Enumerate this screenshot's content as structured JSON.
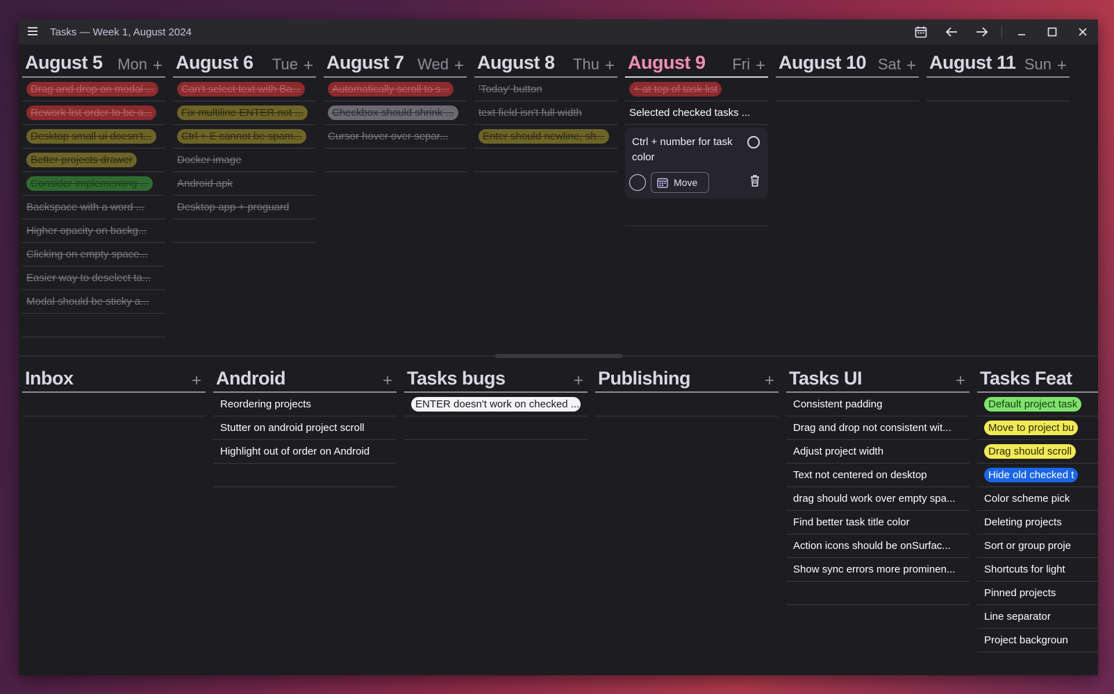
{
  "window": {
    "title": "Tasks — Week 1, August 2024",
    "toolbar": {
      "calendar_icon": "calendar-icon",
      "back_icon": "arrow-left-icon",
      "forward_icon": "arrow-right-icon",
      "minimize_icon": "minimize-icon",
      "maximize_icon": "maximize-icon",
      "close_icon": "close-icon"
    }
  },
  "days": [
    {
      "date": "August 5",
      "weekday": "Mon",
      "add": "+",
      "tasks": [
        {
          "text": "Drag and drop on modal ...",
          "style": "red"
        },
        {
          "text": "Rework list order to be a...",
          "style": "red"
        },
        {
          "text": "Desktop small ui doesn't...",
          "style": "olive"
        },
        {
          "text": "Better projects drawer",
          "style": "olive"
        },
        {
          "text": "Consider implementing ...",
          "style": "green"
        },
        {
          "text": "Backspace with a word ...",
          "style": "plain"
        },
        {
          "text": "Higher opacity on backg...",
          "style": "plain"
        },
        {
          "text": "Clicking on empty space...",
          "style": "plain"
        },
        {
          "text": "Easier way to deselect ta...",
          "style": "plain"
        },
        {
          "text": "Modal should be sticky a...",
          "style": "plain"
        }
      ]
    },
    {
      "date": "August 6",
      "weekday": "Tue",
      "add": "+",
      "tasks": [
        {
          "text": "Can't select text with Ba...",
          "style": "red"
        },
        {
          "text": "Fix multiline ENTER not ...",
          "style": "olive"
        },
        {
          "text": "Ctrl + E cannot be spam...",
          "style": "olive"
        },
        {
          "text": "Docker image",
          "style": "plain"
        },
        {
          "text": "Android apk",
          "style": "plain"
        },
        {
          "text": "Desktop app + proguard",
          "style": "plain"
        }
      ]
    },
    {
      "date": "August 7",
      "weekday": "Wed",
      "add": "+",
      "tasks": [
        {
          "text": "Automatically scroll to s...",
          "style": "red"
        },
        {
          "text": "Checkbox should shrink ...",
          "style": "gray"
        },
        {
          "text": "Cursor hover over separ...",
          "style": "plain"
        }
      ]
    },
    {
      "date": "August 8",
      "weekday": "Thu",
      "add": "+",
      "tasks": [
        {
          "text": "'Today' button",
          "style": "plain"
        },
        {
          "text": "text field isn't full width",
          "style": "plain"
        },
        {
          "text": "Enter should newline, sh...",
          "style": "olive"
        }
      ]
    },
    {
      "date": "August 9",
      "weekday": "Fri",
      "add": "+",
      "today": true,
      "tasks": [
        {
          "text": "+ at top of task list",
          "style": "red"
        },
        {
          "text": "Selected checked tasks ...",
          "style": "active"
        }
      ],
      "editing": {
        "text": "Ctrl + number for task color",
        "move_label": "Move",
        "calendar_icon": "calendar-icon",
        "delete_icon": "trash-icon"
      }
    },
    {
      "date": "August 10",
      "weekday": "Sat",
      "add": "+",
      "tasks": []
    },
    {
      "date": "August 11",
      "weekday": "Sun",
      "add": "+",
      "tasks": []
    }
  ],
  "projects": [
    {
      "name": "Inbox",
      "add": "+",
      "tasks": []
    },
    {
      "name": "Android",
      "add": "+",
      "tasks": [
        {
          "text": "Reordering projects",
          "style": "plain"
        },
        {
          "text": "Stutter on android project scroll",
          "style": "plain"
        },
        {
          "text": "Highlight out of order on Android",
          "style": "plain"
        }
      ]
    },
    {
      "name": "Tasks bugs",
      "add": "+",
      "tasks": [
        {
          "text": "ENTER doesn't work on checked ...",
          "style": "white"
        }
      ]
    },
    {
      "name": "Publishing",
      "add": "+",
      "tasks": []
    },
    {
      "name": "Tasks UI",
      "add": "+",
      "tasks": [
        {
          "text": "Consistent padding",
          "style": "plain"
        },
        {
          "text": "Drag and drop not consistent wit...",
          "style": "plain"
        },
        {
          "text": "Adjust project width",
          "style": "plain"
        },
        {
          "text": "Text not centered on desktop",
          "style": "plain"
        },
        {
          "text": "drag should work over empty spa...",
          "style": "plain"
        },
        {
          "text": "Find better task title color",
          "style": "plain"
        },
        {
          "text": "Action icons should be onSurfac...",
          "style": "plain"
        },
        {
          "text": "Show sync errors more prominen...",
          "style": "plain"
        }
      ]
    },
    {
      "name": "Tasks Feat",
      "add": "+",
      "tasks": [
        {
          "text": "Default project task",
          "style": "lgreen"
        },
        {
          "text": "Move to project bu",
          "style": "yellow"
        },
        {
          "text": "Drag should scroll",
          "style": "yellow"
        },
        {
          "text": "Hide old checked t",
          "style": "blue"
        },
        {
          "text": "Color scheme pick",
          "style": "plain"
        },
        {
          "text": "Deleting projects",
          "style": "plain"
        },
        {
          "text": "Sort or group proje",
          "style": "plain"
        },
        {
          "text": "Shortcuts for light",
          "style": "plain"
        },
        {
          "text": "Pinned projects",
          "style": "plain"
        },
        {
          "text": "Line separator",
          "style": "plain"
        },
        {
          "text": "Project backgroun",
          "style": "plain"
        }
      ]
    }
  ],
  "colors": {
    "today_accent": "#f08fb1",
    "background": "#1d1c20"
  }
}
